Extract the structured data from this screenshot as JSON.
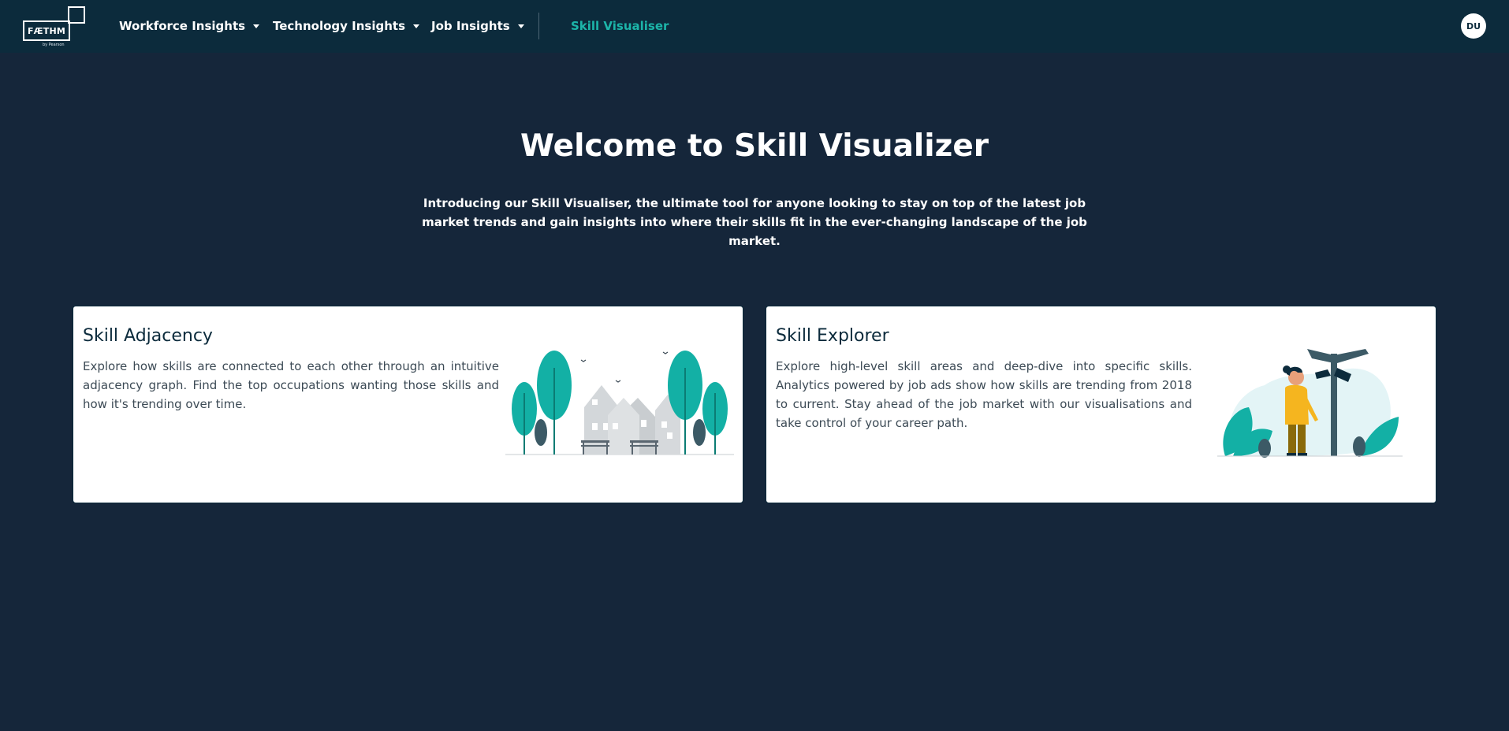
{
  "navbar": {
    "logo_text": "FÆTHM",
    "logo_byline": "by Pearson",
    "items": [
      {
        "label": "Workforce Insights"
      },
      {
        "label": "Technology Insights"
      },
      {
        "label": "Job Insights"
      }
    ],
    "active_item": "Skill Visualiser",
    "avatar_initials": "DU"
  },
  "hero": {
    "title": "Welcome to Skill Visualizer",
    "subtitle": "Introducing our Skill Visualiser, the ultimate tool for anyone looking to stay on top of the latest job market trends and gain insights into where their skills fit in the ever-changing landscape of the job market."
  },
  "cards": [
    {
      "title": "Skill Adjacency",
      "text": "Explore how skills are connected to each other through an intuitive adjacency graph. Find the top occupations wanting those skills and how it's trending over time."
    },
    {
      "title": "Skill Explorer",
      "text": "Explore high-level skill areas and deep-dive into specific skills. Analytics powered by job ads show how skills are trending from 2018 to current. Stay ahead of the job market with our visualisations and take control of your career path."
    }
  ],
  "colors": {
    "page_bg": "#15263a",
    "navbar_bg": "#0c2b3c",
    "accent": "#1cb5a9",
    "card_bg": "#ffffff"
  }
}
